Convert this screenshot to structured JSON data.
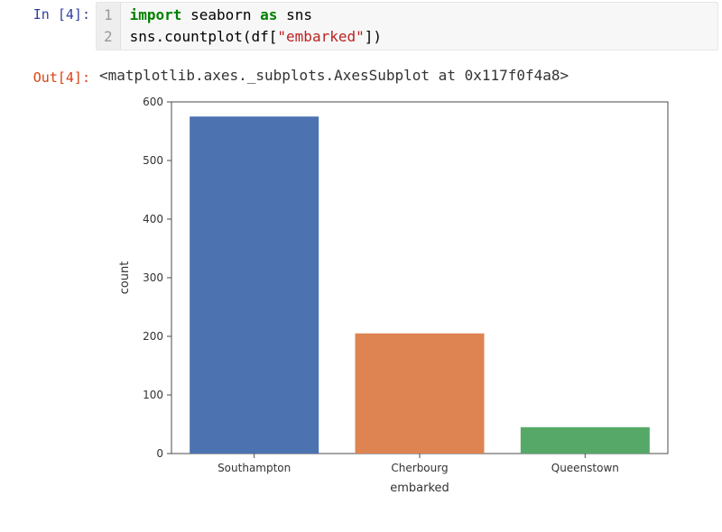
{
  "input": {
    "prompt": "In [4]:",
    "gutter": [
      "1",
      "2"
    ],
    "code": {
      "line1": {
        "kw1": "import",
        "sp1": " ",
        "mod": "seaborn",
        "sp2": " ",
        "kw2": "as",
        "sp3": " ",
        "alias": "sns"
      },
      "line2": {
        "call1": "sns.countplot(df[",
        "str": "\"embarked\"",
        "call2": "])"
      }
    }
  },
  "output": {
    "prompt": "Out[4]:",
    "repr": "<matplotlib.axes._subplots.AxesSubplot at 0x117f0f4a8>"
  },
  "chart_data": {
    "type": "bar",
    "categories": [
      "Southampton",
      "Cherbourg",
      "Queenstown"
    ],
    "values": [
      575,
      205,
      45
    ],
    "colors": [
      "#4C72B0",
      "#DD8452",
      "#55A868"
    ],
    "xlabel": "embarked",
    "ylabel": "count",
    "yticks": [
      0,
      100,
      200,
      300,
      400,
      500,
      600
    ],
    "ylim": [
      0,
      600
    ],
    "title": ""
  }
}
